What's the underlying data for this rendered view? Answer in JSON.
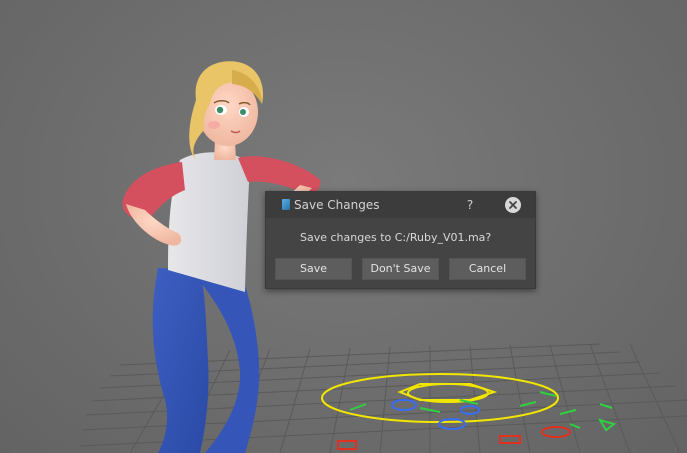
{
  "dialog": {
    "title": "Save Changes",
    "help_label": "?",
    "message": "Save changes to C:/Ruby_V01.ma?",
    "buttons": {
      "save": "Save",
      "dont_save": "Don't Save",
      "cancel": "Cancel"
    }
  },
  "icons": {
    "app": "maya-app-icon",
    "close": "close-icon"
  },
  "colors": {
    "viewport_bg": "#6f6f6f",
    "dialog_bg": "#444444",
    "titlebar_bg": "#3c3c3c",
    "button_bg": "#5d5d5d",
    "control_yellow": "#f2e600",
    "control_green": "#30d040",
    "control_red": "#e03020",
    "control_blue": "#3a6cf0"
  }
}
